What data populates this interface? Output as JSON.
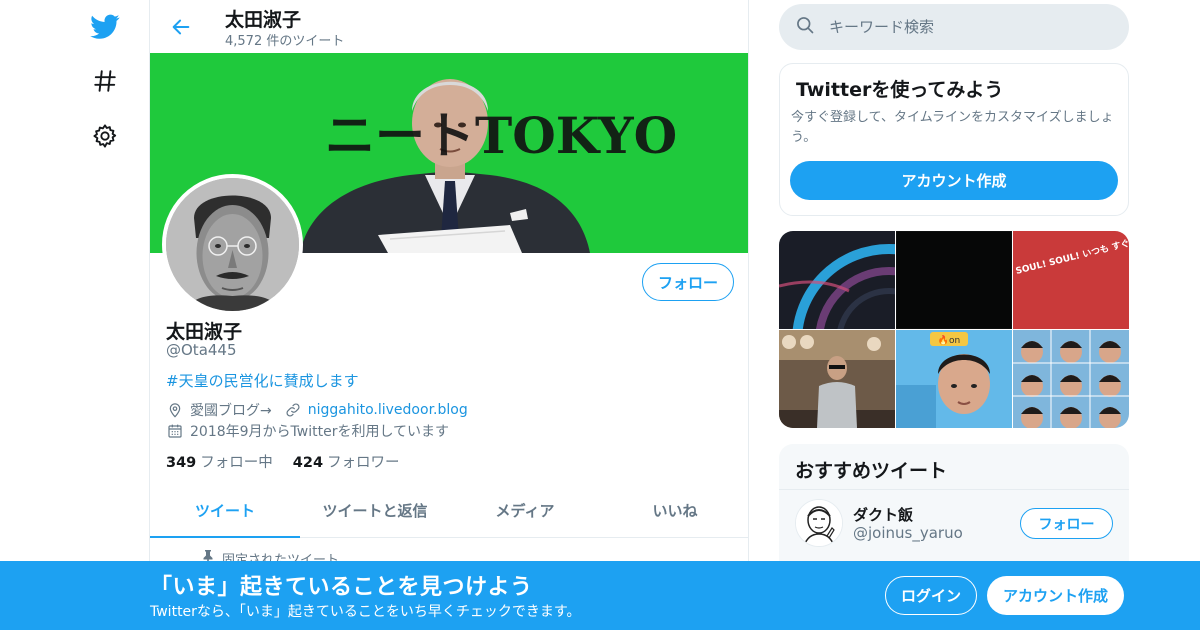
{
  "header": {
    "display_name": "太田淑子",
    "tweet_count": "4,572 件のツイート"
  },
  "banner": {
    "calligraphy": "ニートTOKYO"
  },
  "profile": {
    "name": "太田淑子",
    "handle": "@Ota445",
    "bio": "#天皇の民営化に賛成します",
    "location": "愛國ブログ→",
    "website": "niggahito.livedoor.blog",
    "joined": "2018年9月からTwitterを利用しています",
    "following_count": "349",
    "following_label": "フォロー中",
    "followers_count": "424",
    "followers_label": "フォロワー",
    "follow_button": "フォロー"
  },
  "tabs": [
    {
      "label": "ツイート",
      "active": true
    },
    {
      "label": "ツイートと返信",
      "active": false
    },
    {
      "label": "メディア",
      "active": false
    },
    {
      "label": "いいね",
      "active": false
    }
  ],
  "pinned_label": "固定されたツイート",
  "search": {
    "placeholder": "キーワード検索"
  },
  "signup_card": {
    "title": "Twitterを使ってみよう",
    "description": "今すぐ登録して、タイムラインをカスタマイズしましょう。",
    "button": "アカウント作成"
  },
  "media": {
    "tile3_text": "You are my SOUL! SOUL! いつも すぐそばにある",
    "tile5_badge": "🔥on"
  },
  "recommended": {
    "title": "おすすめツイート",
    "user_name": "ダクト飯",
    "user_handle": "@joinus_yaruo",
    "follow_button": "フォロー"
  },
  "bottom_bar": {
    "headline": "「いま」起きていることを見つけよう",
    "subtext": "Twitterなら、「いま」起きていることをいち早くチェックできます。",
    "login": "ログイン",
    "signup": "アカウント作成"
  },
  "colors": {
    "accent": "#1da1f2",
    "link": "#1b95e0",
    "muted": "#657786",
    "banner_green": "#1fc93c"
  }
}
